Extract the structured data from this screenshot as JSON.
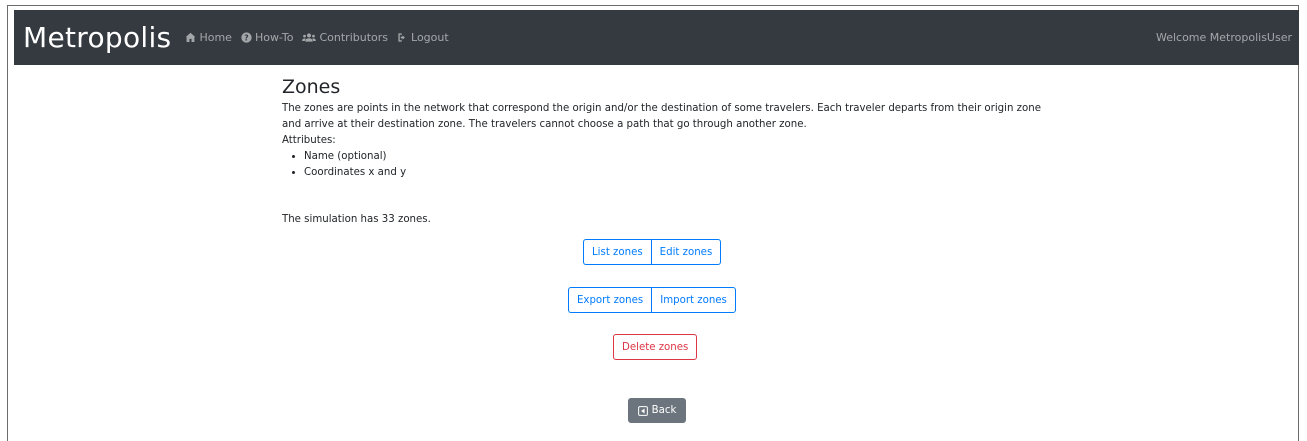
{
  "navbar": {
    "brand": "Metropolis",
    "links": [
      {
        "label": "Home",
        "icon": "home-icon"
      },
      {
        "label": "How-To",
        "icon": "question-circle-icon"
      },
      {
        "label": "Contributors",
        "icon": "users-icon"
      },
      {
        "label": "Logout",
        "icon": "logout-icon"
      }
    ],
    "welcome": "Welcome MetropolisUser"
  },
  "page": {
    "title": "Zones",
    "description": "The zones are points in the network that correspond the origin and/or the destination of some travelers. Each traveler departs from their origin zone and arrive at their destination zone. The travelers cannot choose a path that go through another zone.",
    "attributes_label": "Attributes:",
    "attributes": [
      "Name (optional)",
      "Coordinates x and y"
    ],
    "count_text": "The simulation has 33 zones."
  },
  "buttons": {
    "list": "List zones",
    "edit": "Edit zones",
    "export": "Export zones",
    "import": "Import zones",
    "delete": "Delete zones",
    "back": "Back"
  },
  "colors": {
    "navbar_bg": "#343a40",
    "primary": "#007bff",
    "danger": "#dc3545",
    "secondary": "#6c757d"
  }
}
